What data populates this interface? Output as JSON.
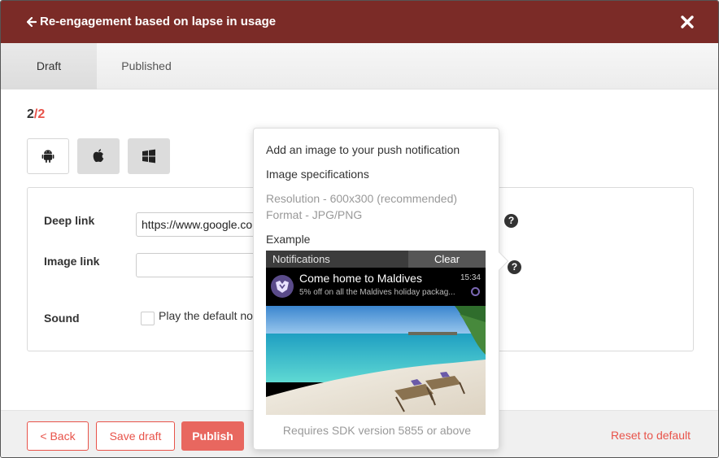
{
  "header": {
    "title": "Re-engagement based on lapse in usage",
    "background_color": "#7b2b27"
  },
  "tabs": [
    {
      "label": "Draft",
      "active": true
    },
    {
      "label": "Published",
      "active": false
    }
  ],
  "step": {
    "current": "2",
    "separator": "/",
    "total": "2"
  },
  "platforms": [
    {
      "name": "android-icon",
      "selected": true
    },
    {
      "name": "apple-icon",
      "selected": false
    },
    {
      "name": "windows-icon",
      "selected": false
    }
  ],
  "form": {
    "deep_link": {
      "label": "Deep link",
      "value": "https://www.google.co"
    },
    "image_link": {
      "label": "Image link",
      "value": ""
    },
    "sound": {
      "label": "Sound",
      "checkbox_label": "Play the default no",
      "checked": false
    }
  },
  "popover": {
    "title": "Add an image to your push notification",
    "specs_heading": "Image specifications",
    "resolution": "Resolution - 600x300 (recommended)",
    "format": "Format - JPG/PNG",
    "example_heading": "Example",
    "requirement": "Requires SDK version 5855 or above",
    "example": {
      "notifications_label": "Notifications",
      "clear_label": "Clear",
      "notification_title": "Come home to Maldives",
      "notification_text": "5% off on all the Maldives holiday packag...",
      "time": "15:34"
    }
  },
  "footer": {
    "back_label": "< Back",
    "save_draft_label": "Save draft",
    "publish_label": "Publish",
    "reset_label": "Reset to default"
  },
  "colors": {
    "accent": "#e8534a",
    "publish": "#e8675f"
  }
}
